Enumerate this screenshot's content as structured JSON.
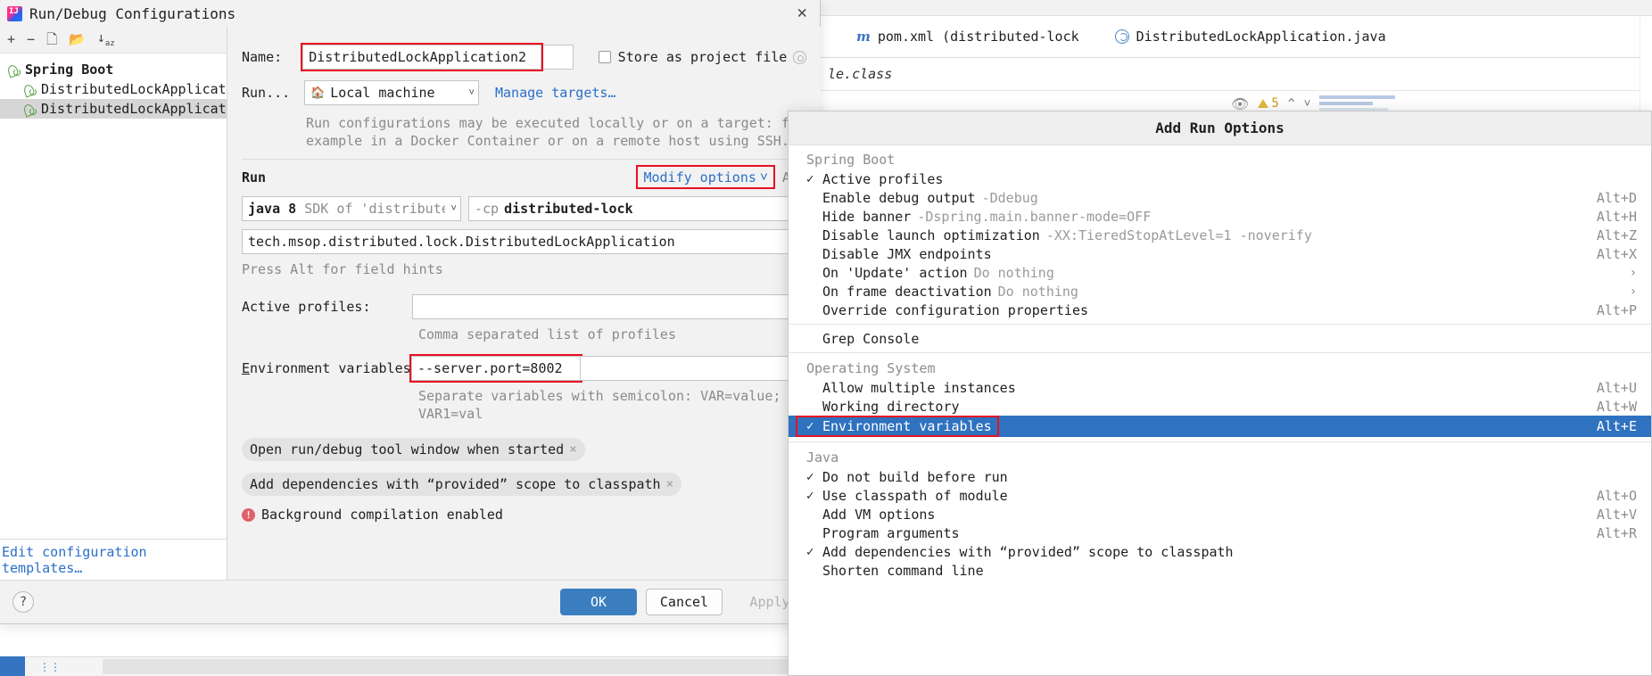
{
  "ide": {
    "tabs": [
      {
        "label": "pom.xml (distributed-lock",
        "icon": "maven-icon"
      },
      {
        "label": "DistributedLockApplication.java",
        "icon": "spring-boot-icon"
      }
    ],
    "editor_text": "le.class",
    "warning_count": "5"
  },
  "dialog": {
    "title": "Run/Debug Configurations",
    "close_label": "✕",
    "toolbar_icons": [
      "add-icon",
      "remove-icon",
      "copy-icon",
      "save-icon",
      "sort-icon"
    ],
    "tree": {
      "group_label": "Spring Boot",
      "items": [
        {
          "label": "DistributedLockApplicatio",
          "selected": false
        },
        {
          "label": "DistributedLockApplicatio",
          "selected": true
        }
      ],
      "footer_link": "Edit configuration templates…"
    },
    "name": {
      "label": "Name:",
      "value": "DistributedLockApplication2",
      "store_as_project_file": "Store as project file",
      "store_checked": false
    },
    "run_on": {
      "label": "Run...",
      "target": "Local machine",
      "manage_targets": "Manage targets…",
      "description_line1": "Run configurations may be executed locally or on a target: for",
      "description_line2": "example in a Docker Container or on a remote host using SSH."
    },
    "run_section": {
      "title": "Run",
      "modify_options": "Modify options",
      "modify_shortcut": "Alt",
      "sdk_value": "java 8",
      "sdk_hint": "SDK of 'distribute",
      "cp_value": "-cp distributed-lock",
      "main_class": "tech.msop.distributed.lock.DistributedLockApplication",
      "field_hint": "Press Alt for field hints"
    },
    "active_profiles": {
      "label": "Active profiles:",
      "value": "",
      "hint": "Comma separated list of profiles"
    },
    "env_vars": {
      "label": "Environment variables:",
      "label_mnemonic": "E",
      "value": "--server.port=8002",
      "hint": "Separate variables with semicolon: VAR=value; VAR1=val"
    },
    "chips": [
      {
        "label": "Open run/debug tool window when started",
        "close": "×"
      },
      {
        "label": "Add dependencies with “provided” scope to classpath",
        "close": "×"
      }
    ],
    "warning": "Background compilation enabled",
    "footer": {
      "help": "?",
      "ok": "OK",
      "cancel": "Cancel",
      "apply": "Apply"
    }
  },
  "popup": {
    "title": "Add Run Options",
    "groups": [
      {
        "name": "Spring Boot",
        "items": [
          {
            "checked": true,
            "text": "Active profiles",
            "arg": "",
            "shortcut": ""
          },
          {
            "checked": false,
            "text": "Enable debug output",
            "arg": "-Ddebug",
            "shortcut": "Alt+D"
          },
          {
            "checked": false,
            "text": "Hide banner",
            "arg": "-Dspring.main.banner-mode=OFF",
            "shortcut": "Alt+H"
          },
          {
            "checked": false,
            "text": "Disable launch optimization",
            "arg": "-XX:TieredStopAtLevel=1 -noverify",
            "shortcut": "Alt+Z"
          },
          {
            "checked": false,
            "text": "Disable JMX endpoints",
            "arg": "",
            "shortcut": "Alt+X"
          },
          {
            "checked": false,
            "text": "On 'Update' action",
            "arg": "Do nothing",
            "shortcut": "",
            "submenu": "›"
          },
          {
            "checked": false,
            "text": "On frame deactivation",
            "arg": "Do nothing",
            "shortcut": "",
            "submenu": "›"
          },
          {
            "checked": false,
            "text": "Override configuration properties",
            "arg": "",
            "shortcut": "Alt+P"
          }
        ]
      },
      {
        "name": "",
        "items": [
          {
            "checked": false,
            "text": "Grep Console",
            "arg": "",
            "shortcut": ""
          }
        ]
      },
      {
        "name": "Operating System",
        "items": [
          {
            "checked": false,
            "text": "Allow multiple instances",
            "arg": "",
            "shortcut": "Alt+U"
          },
          {
            "checked": false,
            "text": "Working directory",
            "arg": "",
            "shortcut": "Alt+W"
          },
          {
            "checked": true,
            "text": "Environment variables",
            "arg": "",
            "shortcut": "Alt+E",
            "selected": true,
            "highlighted": true
          }
        ]
      },
      {
        "name": "Java",
        "items": [
          {
            "checked": true,
            "text": "Do not build before run",
            "arg": "",
            "shortcut": ""
          },
          {
            "checked": true,
            "text": "Use classpath of module",
            "arg": "",
            "shortcut": "Alt+O"
          },
          {
            "checked": false,
            "text": "Add VM options",
            "arg": "",
            "shortcut": "Alt+V"
          },
          {
            "checked": false,
            "text": "Program arguments",
            "arg": "",
            "shortcut": "Alt+R"
          },
          {
            "checked": true,
            "text": "Add dependencies with “provided” scope to classpath",
            "arg": "",
            "shortcut": ""
          },
          {
            "checked": false,
            "text": "Shorten command line",
            "arg": "",
            "shortcut": ""
          }
        ]
      }
    ]
  },
  "colors": {
    "accent": "#2f72bf",
    "highlight_red": "#e81123",
    "link": "#2a6fc9",
    "muted": "#8d8d8d"
  }
}
